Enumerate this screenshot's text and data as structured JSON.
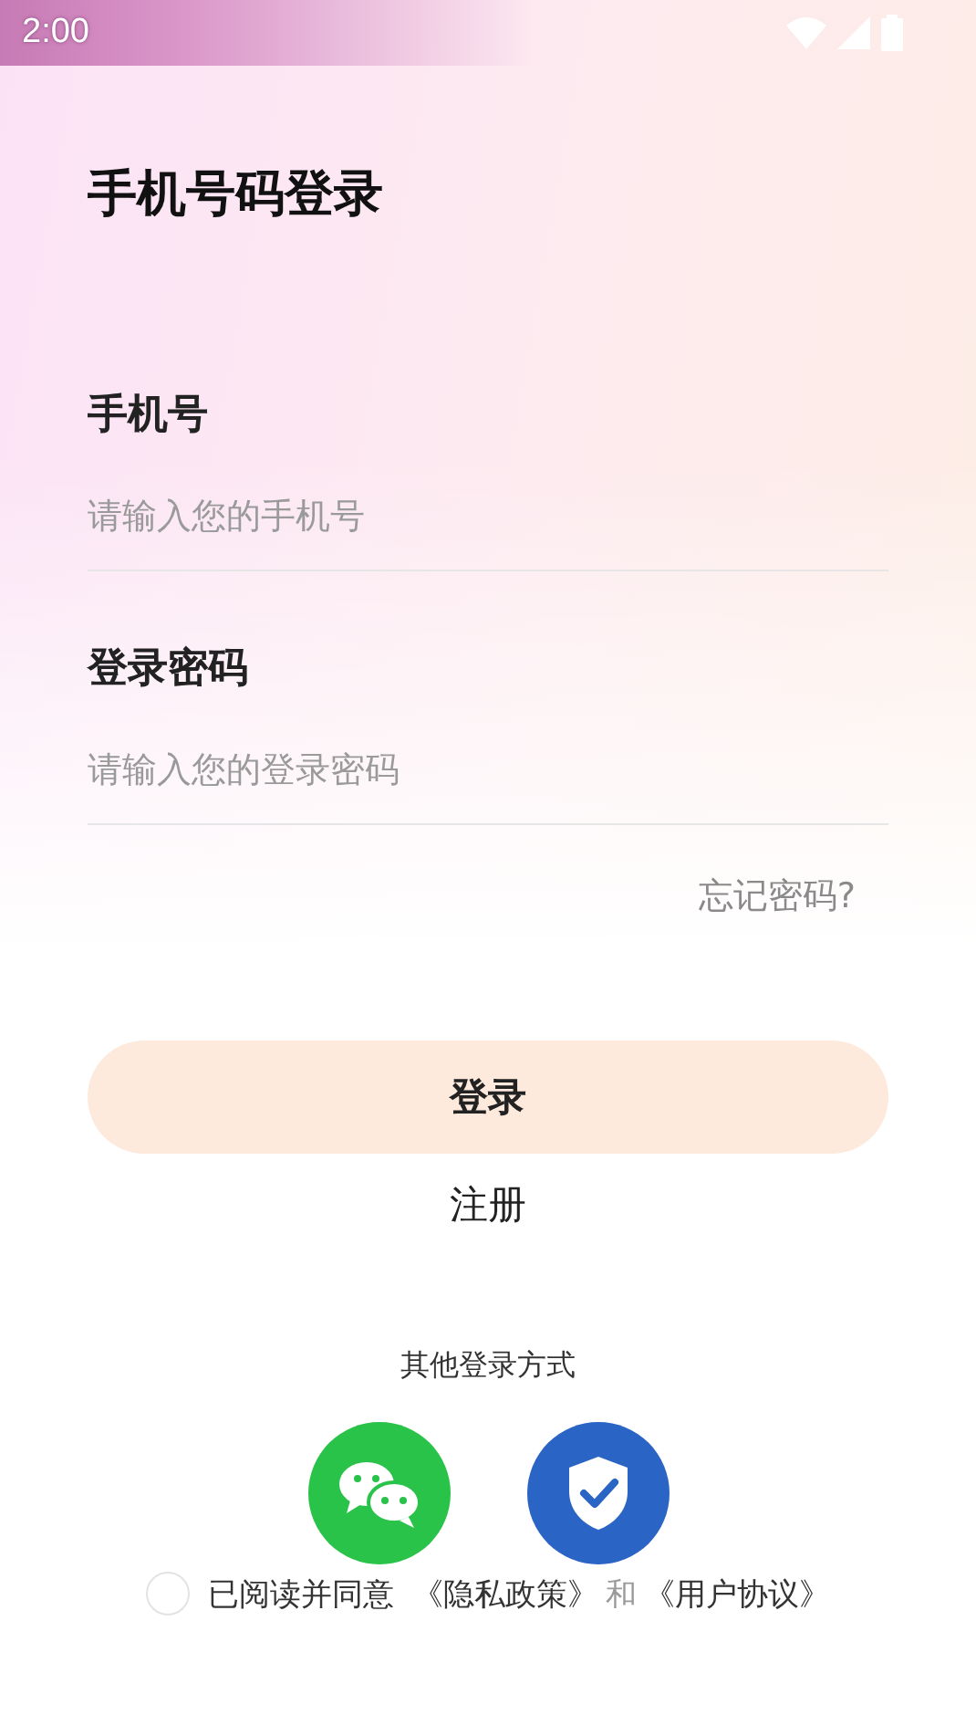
{
  "status_bar": {
    "time": "2:00"
  },
  "title": "手机号码登录",
  "fields": [
    {
      "label": "手机号",
      "placeholder": "请输入您的手机号"
    },
    {
      "label": "登录密码",
      "placeholder": "请输入您的登录密码"
    }
  ],
  "forgot_link": "忘记密码?",
  "login_button": "登录",
  "register_link": "注册",
  "other_methods": {
    "title": "其他登录方式",
    "options": [
      {
        "kind": "chat"
      },
      {
        "kind": "shield"
      }
    ]
  },
  "agreement": {
    "checked": false,
    "prefix": "已阅读并同意",
    "policy_link": "《隐私政策》",
    "joiner": "和",
    "terms_link": "《用户协议》"
  }
}
